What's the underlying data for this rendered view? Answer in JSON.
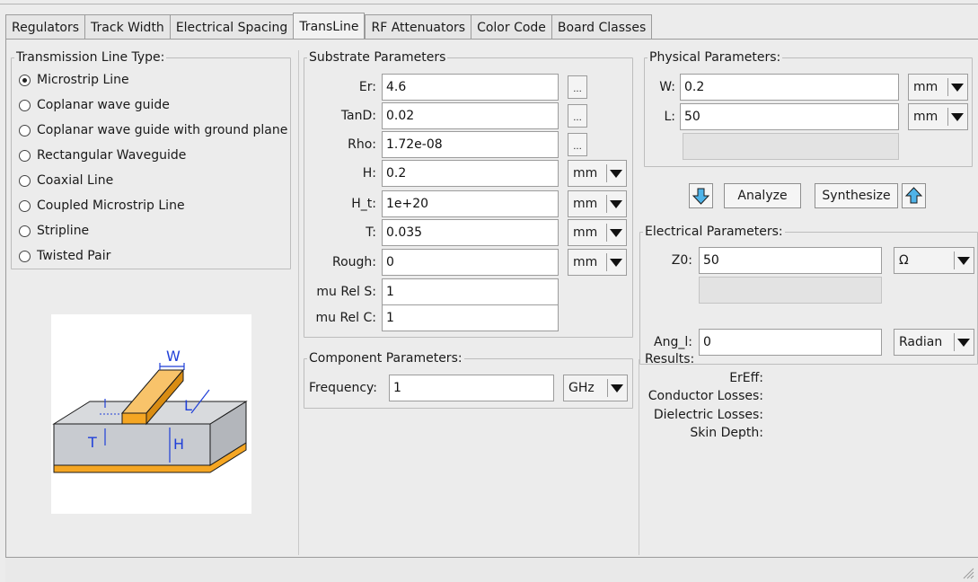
{
  "tabs": [
    "Regulators",
    "Track Width",
    "Electrical Spacing",
    "TransLine",
    "RF Attenuators",
    "Color Code",
    "Board Classes"
  ],
  "active_tab": "TransLine",
  "transmission_line": {
    "title": "Transmission Line Type:",
    "options": [
      "Microstrip Line",
      "Coplanar wave guide",
      "Coplanar wave guide with ground plane",
      "Rectangular Waveguide",
      "Coaxial Line",
      "Coupled Microstrip Line",
      "Stripline",
      "Twisted Pair"
    ],
    "selected": "Microstrip Line"
  },
  "diagram": {
    "labels": {
      "w": "W",
      "l": "L",
      "t": "T",
      "h": "H"
    },
    "colors": {
      "copper": "#f5a623",
      "substrate": "#c8cbd0",
      "dimension": "#1f3fd8"
    }
  },
  "substrate": {
    "title": "Substrate Parameters",
    "rows": [
      {
        "label": "Er:",
        "value": "4.6",
        "button": "...",
        "unit": ""
      },
      {
        "label": "TanD:",
        "value": "0.02",
        "button": "...",
        "unit": ""
      },
      {
        "label": "Rho:",
        "value": "1.72e-08",
        "button": "...",
        "unit": ""
      },
      {
        "label": "H:",
        "value": "0.2",
        "button": "",
        "unit": "mm"
      },
      {
        "label": "H_t:",
        "value": "1e+20",
        "button": "",
        "unit": "mm"
      },
      {
        "label": "T:",
        "value": "0.035",
        "button": "",
        "unit": "mm"
      },
      {
        "label": "Rough:",
        "value": "0",
        "button": "",
        "unit": "mm"
      },
      {
        "label": "mu Rel S:",
        "value": "1",
        "button": "",
        "unit": ""
      },
      {
        "label": "mu Rel C:",
        "value": "1",
        "button": "",
        "unit": ""
      }
    ]
  },
  "component": {
    "title": "Component Parameters:",
    "frequency_label": "Frequency:",
    "frequency_value": "1",
    "frequency_unit": "GHz"
  },
  "physical": {
    "title": "Physical Parameters:",
    "w_label": "W:",
    "w_value": "0.2",
    "w_unit": "mm",
    "l_label": "L:",
    "l_value": "50",
    "l_unit": "mm",
    "extra_value": ""
  },
  "actions": {
    "analyze": "Analyze",
    "synthesize": "Synthesize"
  },
  "electrical": {
    "title": "Electrical Parameters:",
    "z0_label": "Z0:",
    "z0_value": "50",
    "z0_unit": "Ω",
    "extra_value": "",
    "ang_label": "Ang_l:",
    "ang_value": "0",
    "ang_unit": "Radian"
  },
  "results": {
    "title": "Results:",
    "items": [
      "ErEff:",
      "Conductor Losses:",
      "Dielectric Losses:",
      "Skin Depth:"
    ]
  },
  "status_text": ""
}
